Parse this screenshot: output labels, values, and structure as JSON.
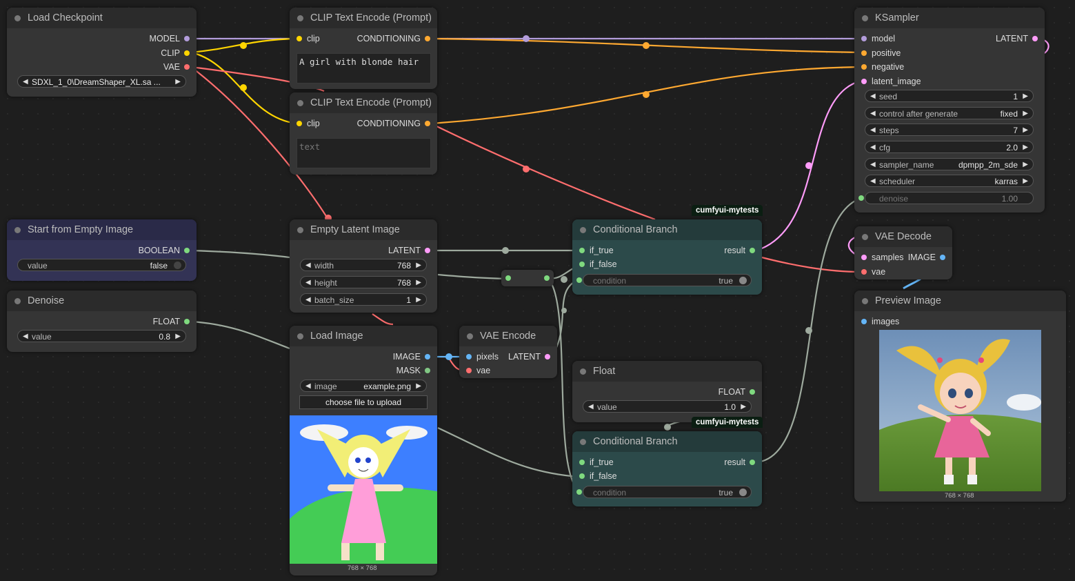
{
  "colors": {
    "model": "#b39ddb",
    "clip": "#ffd500",
    "vae": "#ff6e6e",
    "conditioning": "#ffa931",
    "latent": "#ff9cf9",
    "image": "#64b5f6",
    "mask": "#81c784",
    "generic": "#7fd97f",
    "link_generic": "#9eaa9e"
  },
  "nodes": {
    "load_checkpoint": {
      "title": "Load Checkpoint",
      "outputs": [
        "MODEL",
        "CLIP",
        "VAE"
      ],
      "ckpt_name": "SDXL_1_0\\DreamShaper_XL.sa ..."
    },
    "clip_text_encode_1": {
      "title": "CLIP Text Encode (Prompt)",
      "input": "clip",
      "output": "CONDITIONING",
      "text": "A girl with blonde hair"
    },
    "clip_text_encode_2": {
      "title": "CLIP Text Encode (Prompt)",
      "input": "clip",
      "output": "CONDITIONING",
      "placeholder": "text"
    },
    "ksampler": {
      "title": "KSampler",
      "inputs": [
        "model",
        "positive",
        "negative",
        "latent_image"
      ],
      "output": "LATENT",
      "widgets": [
        {
          "label": "seed",
          "value": "1"
        },
        {
          "label": "control after generate",
          "value": "fixed"
        },
        {
          "label": "steps",
          "value": "7"
        },
        {
          "label": "cfg",
          "value": "2.0"
        },
        {
          "label": "sampler_name",
          "value": "dpmpp_2m_sde"
        },
        {
          "label": "scheduler",
          "value": "karras"
        }
      ],
      "denoise": {
        "label": "denoise",
        "value": "1.00"
      }
    },
    "start_from_empty": {
      "title": "Start from Empty Image",
      "output": "BOOLEAN",
      "toggle": {
        "label": "value",
        "value": "false"
      }
    },
    "denoise": {
      "title": "Denoise",
      "output": "FLOAT",
      "widget": {
        "label": "value",
        "value": "0.8"
      }
    },
    "empty_latent": {
      "title": "Empty Latent Image",
      "output": "LATENT",
      "widgets": [
        {
          "label": "width",
          "value": "768"
        },
        {
          "label": "height",
          "value": "768"
        },
        {
          "label": "batch_size",
          "value": "1"
        }
      ]
    },
    "load_image": {
      "title": "Load Image",
      "outputs": [
        "IMAGE",
        "MASK"
      ],
      "image_widget": {
        "label": "image",
        "value": "example.png"
      },
      "upload_button": "choose file to upload",
      "caption": "768 × 768"
    },
    "vae_encode": {
      "title": "VAE Encode",
      "inputs": [
        "pixels",
        "vae"
      ],
      "output": "LATENT"
    },
    "cond_branch_1": {
      "badge": "cumfyui-mytests",
      "title": "Conditional Branch",
      "inputs": [
        "if_true",
        "if_false"
      ],
      "output": "result",
      "condition": {
        "label": "condition",
        "value": "true"
      }
    },
    "float_node": {
      "title": "Float",
      "output": "FLOAT",
      "widget": {
        "label": "value",
        "value": "1.0"
      }
    },
    "cond_branch_2": {
      "badge": "cumfyui-mytests",
      "title": "Conditional Branch",
      "inputs": [
        "if_true",
        "if_false"
      ],
      "output": "result",
      "condition": {
        "label": "condition",
        "value": "true"
      }
    },
    "vae_decode": {
      "title": "VAE Decode",
      "inputs": [
        "samples",
        "vae"
      ],
      "output": "IMAGE"
    },
    "preview_image": {
      "title": "Preview Image",
      "input": "images",
      "caption": "768 × 768"
    }
  }
}
